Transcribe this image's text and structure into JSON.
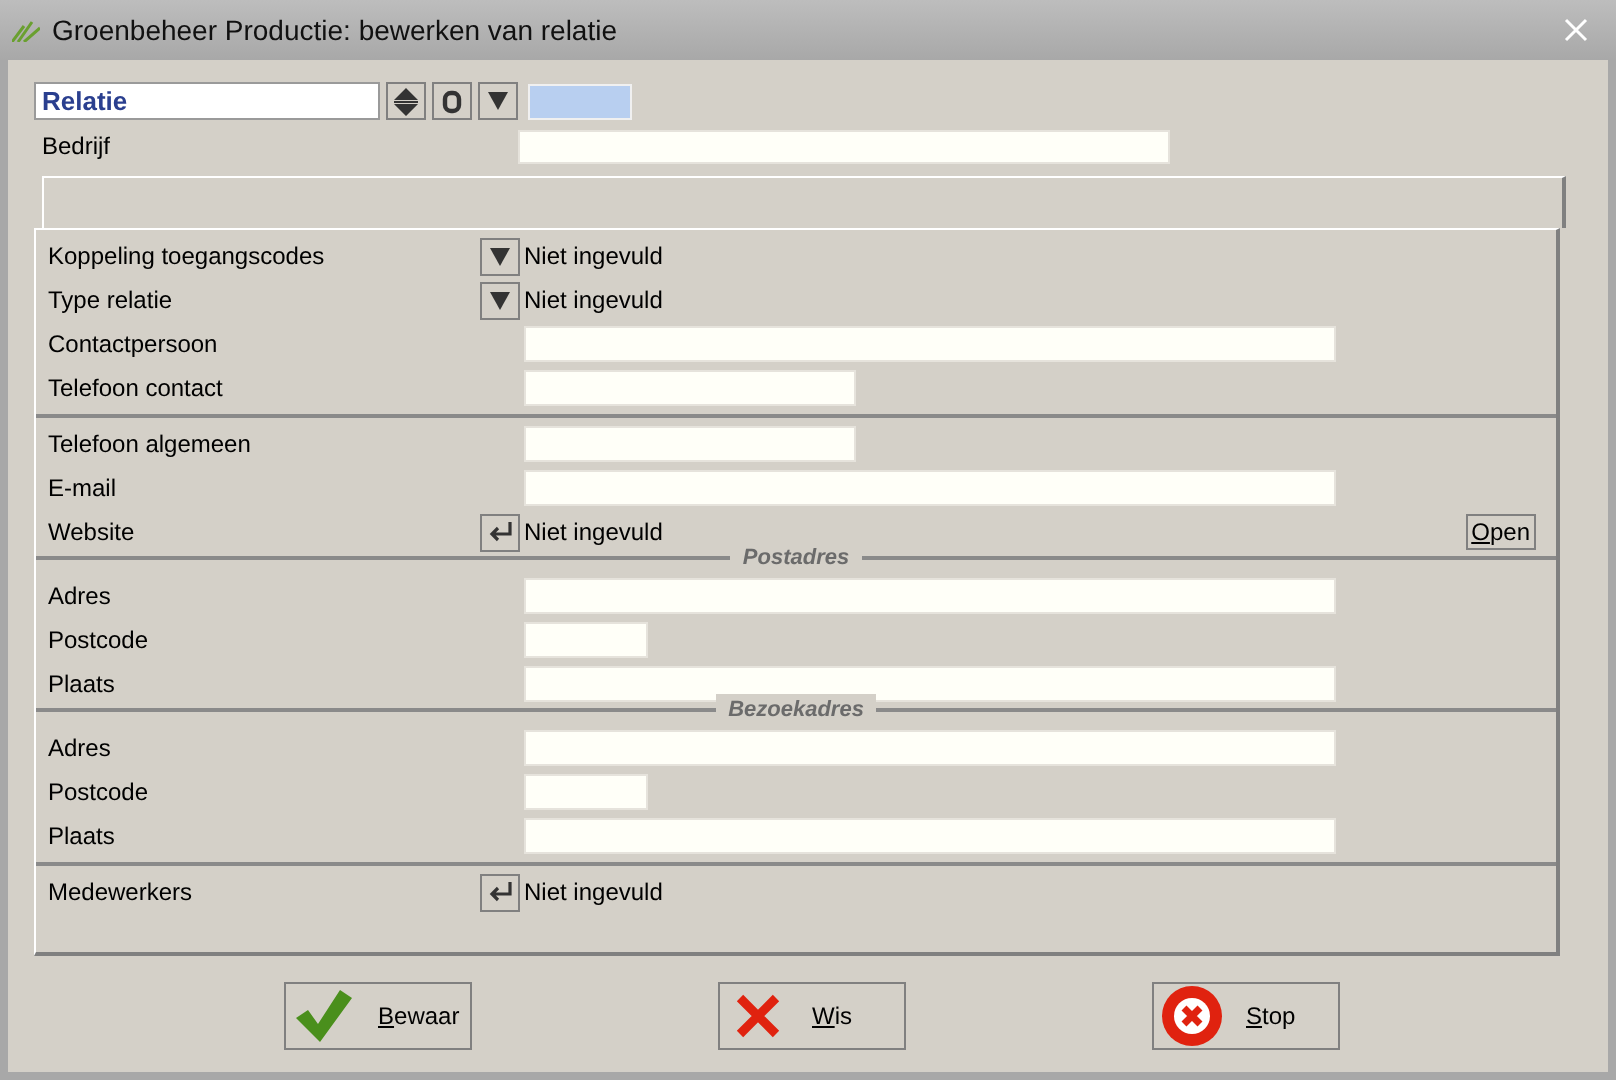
{
  "window": {
    "title": "Groenbeheer Productie: bewerken van relatie"
  },
  "header": {
    "record_value": "Relatie",
    "company_label": "Bedrijf"
  },
  "sections": [
    {
      "rows": [
        {
          "kind": "dropdown",
          "label": "Koppeling toegangscodes",
          "value": "Niet ingevuld"
        },
        {
          "kind": "dropdown",
          "label": "Type relatie",
          "value": "Niet ingevuld"
        },
        {
          "kind": "text",
          "label": "Contactpersoon"
        },
        {
          "kind": "phone",
          "label": "Telefoon contact"
        }
      ]
    },
    {
      "rows": [
        {
          "kind": "phone",
          "label": "Telefoon algemeen"
        },
        {
          "kind": "text",
          "label": "E-mail"
        },
        {
          "kind": "link",
          "label": "Website",
          "value": "Niet ingevuld",
          "button": "Open"
        }
      ]
    },
    {
      "heading": "Postadres",
      "rows": [
        {
          "kind": "text",
          "label": "Adres"
        },
        {
          "kind": "postcode",
          "label": "Postcode"
        },
        {
          "kind": "text",
          "label": "Plaats"
        }
      ]
    },
    {
      "heading": "Bezoekadres",
      "rows": [
        {
          "kind": "text",
          "label": "Adres"
        },
        {
          "kind": "postcode",
          "label": "Postcode"
        },
        {
          "kind": "text",
          "label": "Plaats"
        }
      ]
    },
    {
      "rows": [
        {
          "kind": "link",
          "label": "Medewerkers",
          "value": "Niet ingevuld"
        }
      ]
    }
  ],
  "buttons": [
    {
      "kind": "save",
      "label": "Bewaar"
    },
    {
      "kind": "clear",
      "label": "Wis"
    },
    {
      "kind": "stop",
      "label": "Stop"
    }
  ]
}
